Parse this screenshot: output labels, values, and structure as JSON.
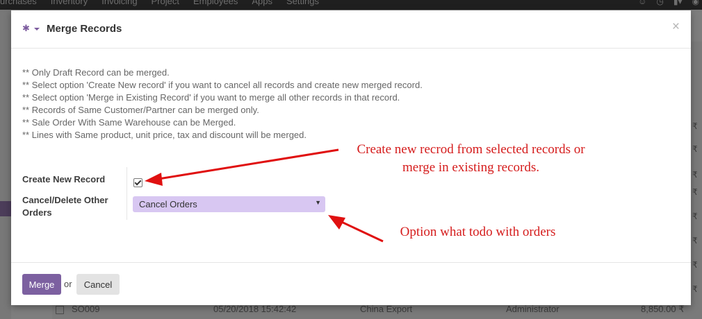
{
  "background": {
    "menu": [
      "urchases",
      "Inventory",
      "Invoicing",
      "Project",
      "Employees",
      "Apps",
      "Settings"
    ],
    "row": {
      "ref": "SO009",
      "date": "05/20/2018 15:42:42",
      "team": "China Export",
      "user": "Administrator",
      "amount": "8,850.00 ₹"
    },
    "currency": "₹"
  },
  "modal": {
    "title": "Merge Records",
    "notes": [
      "** Only Draft Record can be merged.",
      "** Select option 'Create New record' if you want to cancel all records and create new merged record.",
      "** Select option 'Merge in Existing Record' if you want to merge all other records in that record.",
      "** Records of Same Customer/Partner can be merged only.",
      "** Sale Order With Same Warehouse can be Merged.",
      "** Lines with Same product, unit price, tax and discount will be merged."
    ],
    "fields": {
      "create_new_label": "Create New Record",
      "create_new_checked": true,
      "cancel_label_line1": "Cancel/Delete Other",
      "cancel_label_line2": "Orders",
      "cancel_value": "Cancel Orders"
    },
    "footer": {
      "merge": "Merge",
      "or": "or",
      "cancel": "Cancel"
    }
  },
  "annotations": {
    "top_line1": "Create new recrod from selected records or",
    "top_line2": "merge in existing records.",
    "bottom": "Option what todo with orders"
  },
  "colors": {
    "accent": "#7c60a0",
    "select_bg": "#d8c7f2",
    "annotation": "#d51c1c"
  }
}
